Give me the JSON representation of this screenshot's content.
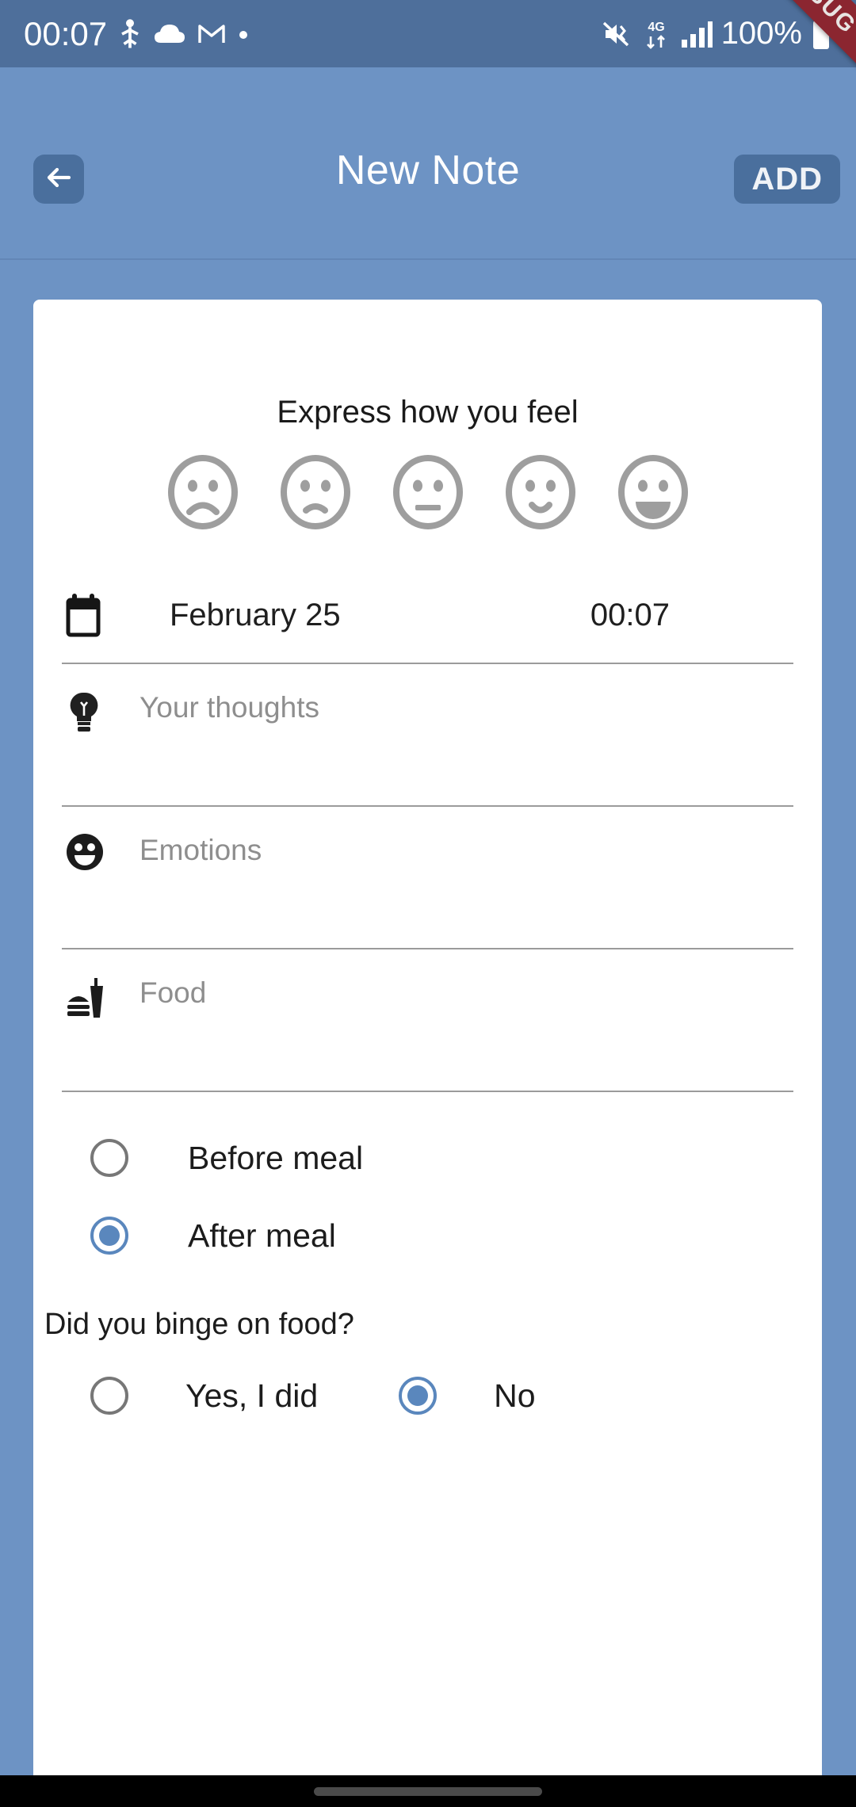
{
  "status_bar": {
    "clock": "00:07",
    "battery_percent": "100%",
    "network": "4G",
    "icons": [
      "usb-debug-icon",
      "cloud-icon",
      "gmail-icon",
      "dot-icon",
      "mute-vibrate-icon",
      "data-transfer-icon",
      "signal-bars-icon",
      "battery-icon"
    ],
    "background_color": "#4e6f9b",
    "text_color": "#ffffff"
  },
  "debug_ribbon": {
    "label": "DEBUG",
    "color": "#8b2630"
  },
  "app_bar": {
    "title": "New Note",
    "back_label": "",
    "add_label": "ADD",
    "background_color": "#6d93c4",
    "button_color": "#4a6f9d"
  },
  "card": {
    "mood": {
      "title": "Express how you feel",
      "faces": [
        {
          "name": "very-sad",
          "selected": false
        },
        {
          "name": "sad",
          "selected": false
        },
        {
          "name": "neutral",
          "selected": false
        },
        {
          "name": "slightly-happy",
          "selected": false
        },
        {
          "name": "happy",
          "selected": false
        }
      ],
      "face_color": "#9e9e9e"
    },
    "date_row": {
      "icon": "calendar-icon",
      "date": "February 25",
      "time": "00:07"
    },
    "fields": [
      {
        "icon": "lightbulb-icon",
        "placeholder": "Your thoughts",
        "value": ""
      },
      {
        "icon": "smiley-face-icon",
        "placeholder": "Emotions",
        "value": ""
      },
      {
        "icon": "fast-food-icon",
        "placeholder": "Food",
        "value": ""
      }
    ],
    "meal_timing": {
      "options": [
        {
          "label": "Before meal",
          "selected": false
        },
        {
          "label": "After meal",
          "selected": true
        }
      ]
    },
    "binge": {
      "question": "Did you binge on food?",
      "options": [
        {
          "label": "Yes, I did",
          "selected": false
        },
        {
          "label": "No",
          "selected": true
        }
      ]
    },
    "accent_color": "#5a87bd",
    "placeholder_color": "#8e8e8e"
  },
  "nav_bar": {
    "gesture_pill": "home-indicator"
  }
}
